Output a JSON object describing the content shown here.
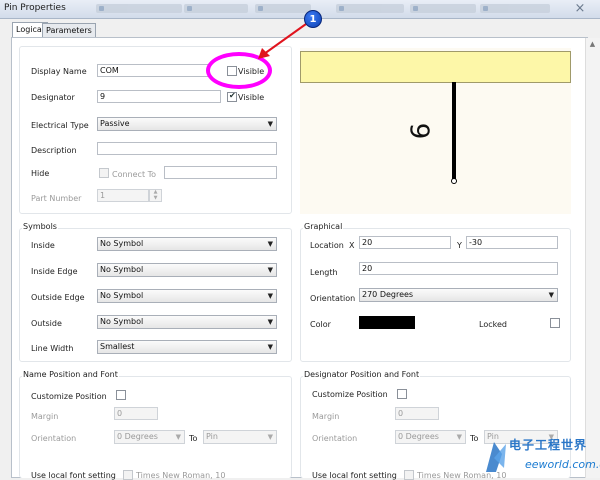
{
  "window": {
    "title": "Pin Properties",
    "close_glyph": "×"
  },
  "tabs": [
    {
      "label": "Logical"
    },
    {
      "label": "Parameters"
    }
  ],
  "logical": {
    "display_name": {
      "label": "Display Name",
      "value": "COM",
      "visible_label": "Visible",
      "visible_checked": false
    },
    "designator": {
      "label": "Designator",
      "value": "9",
      "visible_label": "Visible",
      "visible_checked": true
    },
    "electrical_type": {
      "label": "Electrical Type",
      "value": "Passive"
    },
    "description": {
      "label": "Description",
      "value": ""
    },
    "hide": {
      "label": "Hide",
      "connect_to_label": "Connect To",
      "checked": false,
      "value": ""
    },
    "part_number": {
      "label": "Part Number",
      "value": "1"
    }
  },
  "preview": {
    "pin_designator": "9",
    "fill_color": "#fdf7a8"
  },
  "symbols": {
    "title": "Symbols",
    "inside": {
      "label": "Inside",
      "value": "No Symbol"
    },
    "inside_edge": {
      "label": "Inside Edge",
      "value": "No Symbol"
    },
    "outside_edge": {
      "label": "Outside Edge",
      "value": "No Symbol"
    },
    "outside": {
      "label": "Outside",
      "value": "No Symbol"
    },
    "line_width": {
      "label": "Line Width",
      "value": "Smallest"
    }
  },
  "graphical": {
    "title": "Graphical",
    "location_label": "Location",
    "x_label": "X",
    "x_value": "20",
    "y_label": "Y",
    "y_value": "-30",
    "length_label": "Length",
    "length_value": "20",
    "orientation_label": "Orientation",
    "orientation_value": "270 Degrees",
    "color_label": "Color",
    "color_value": "#000000",
    "locked_label": "Locked",
    "locked_checked": false
  },
  "name_position": {
    "title": "Name Position and Font",
    "customize_label": "Customize Position",
    "margin_label": "Margin",
    "margin_value": "0",
    "orientation_label": "Orientation",
    "orientation_value": "0 Degrees",
    "to_label": "To",
    "to_value": "Pin",
    "font_label": "Use local font setting",
    "font_value": "Times New Roman, 10"
  },
  "designator_position": {
    "title": "Designator Position and Font",
    "customize_label": "Customize Position",
    "margin_label": "Margin",
    "margin_value": "0",
    "orientation_label": "Orientation",
    "orientation_value": "0 Degrees",
    "to_label": "To",
    "to_value": "Pin",
    "font_label": "Use local font setting",
    "font_value": "Times New Roman, 10"
  },
  "annotation": {
    "badge_number": "1",
    "highlight_color": "#ff00ff",
    "arrow_color": "#e0141e"
  },
  "watermark": {
    "cn": "电子工程世界",
    "en": "eeworld.com.cn"
  },
  "icons": {
    "caret": "▼",
    "check": "✔",
    "spin_up": "▲",
    "spin_down": "▼"
  }
}
